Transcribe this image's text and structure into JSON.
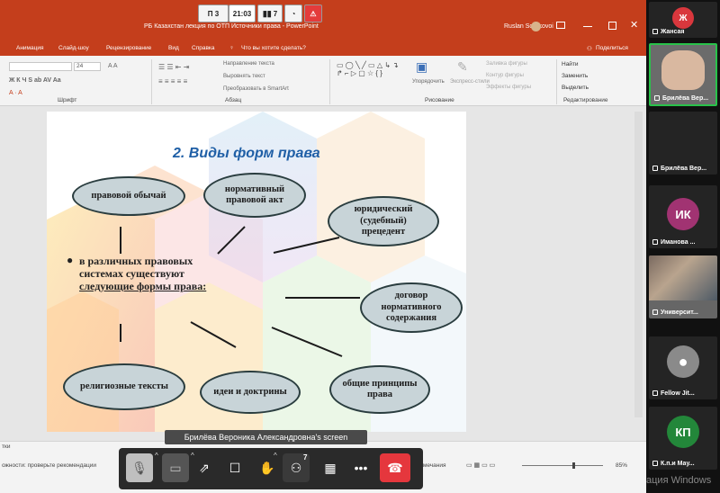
{
  "topbar": {
    "page": "П 3",
    "time": "21:03",
    "participants": "7"
  },
  "ppt": {
    "title": "РБ Казахстан лекция по ОТП Источники права  -  PowerPoint",
    "user": "Ruslan Sorokovoi",
    "tabs": [
      "Анимация",
      "Слайд-шоу",
      "Рецензирование",
      "Вид",
      "Справка"
    ],
    "tell_me": "Что вы хотите сделать?",
    "share": "Поделиться",
    "ribbon": {
      "font_size": "24",
      "font_group": "Шрифт",
      "paragraph_group": "Абзац",
      "drawing_group": "Рисование",
      "editing_group": "Редактирование",
      "text_direction": "Направление текста",
      "align_text": "Выровнять текст",
      "smartart": "Преобразовать в SmartArt",
      "arrange": "Упорядочить",
      "quick_styles": "Экспресс-стили",
      "shape_fill": "Заливка фигуры",
      "shape_outline": "Контур фигуры",
      "shape_effects": "Эффекты фигуры",
      "find": "Найти",
      "replace": "Заменить",
      "select": "Выделить"
    },
    "status": {
      "left_top": "тки",
      "left_bottom": "ожности: проверьте рекомендации",
      "notes": "Примечания",
      "zoom": "85%"
    }
  },
  "slide": {
    "title": "2. Виды форм права",
    "bullet": {
      "line1": "в различных правовых",
      "line2": "системах существуют",
      "line3": "следующие формы права:"
    },
    "ellipses": {
      "custom": "правовой обычай",
      "normative_act": [
        "нормативный",
        "правовой акт"
      ],
      "precedent": [
        "юридический",
        "(судебный)",
        "прецедент"
      ],
      "contract": [
        "договор",
        "нормативного",
        "содержания"
      ],
      "religious": "религиозные тексты",
      "doctrines": "идеи и доктрины",
      "principles": [
        "общие принципы",
        "права"
      ]
    }
  },
  "screen_label": "Брилёва Вероника Александровна's screen",
  "toolbar": {
    "participants_count": "7"
  },
  "participants": [
    {
      "initials": "Ж",
      "name": "Жансая",
      "color": "#d9373d"
    },
    {
      "initials": "",
      "name": "Брилёва Вер...",
      "color": "#6b6b6b"
    },
    {
      "initials": "",
      "name": "Брилёва Вер...",
      "color": "#242424"
    },
    {
      "initials": "ИК",
      "name": "Иманова ...",
      "color": "#a13372"
    },
    {
      "initials": "",
      "name": "Университ...",
      "color": "#555555"
    },
    {
      "initials": "",
      "name": "Fellow Jit...",
      "color": "#8a8a8a"
    },
    {
      "initials": "КП",
      "name": "К.п.и Мау...",
      "color": "#23873a"
    }
  ],
  "watermark": "ация Windows"
}
